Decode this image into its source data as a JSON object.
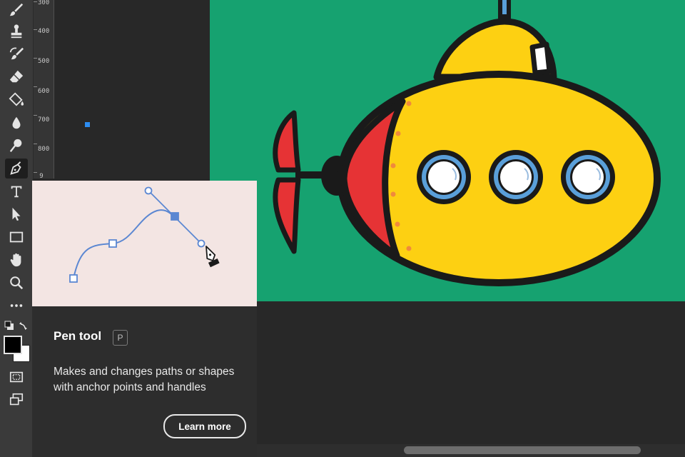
{
  "toolbar": {
    "tools": [
      {
        "name": "brush-tool-icon",
        "active": false
      },
      {
        "name": "clone-stamp-tool-icon",
        "active": false
      },
      {
        "name": "history-brush-tool-icon",
        "active": false
      },
      {
        "name": "eraser-tool-icon",
        "active": false
      },
      {
        "name": "paint-bucket-tool-icon",
        "active": false
      },
      {
        "name": "blur-tool-icon",
        "active": false
      },
      {
        "name": "dodge-tool-icon",
        "active": false
      },
      {
        "name": "pen-tool-icon",
        "active": true
      },
      {
        "name": "type-tool-icon",
        "active": false
      },
      {
        "name": "path-selection-tool-icon",
        "active": false
      },
      {
        "name": "rectangle-tool-icon",
        "active": false
      },
      {
        "name": "hand-tool-icon",
        "active": false
      },
      {
        "name": "zoom-tool-icon",
        "active": false
      },
      {
        "name": "more-tools-icon",
        "active": false
      }
    ],
    "foreground_color": "#000000",
    "background_color": "#ffffff"
  },
  "ruler": {
    "labels": [
      "300",
      "400",
      "500",
      "600",
      "700",
      "800",
      "9"
    ]
  },
  "canvas": {
    "background_color": "#16a270",
    "accent_colors": {
      "submarine_body": "#fdd012",
      "fin": "#e63335",
      "porthole_ring": "#5a9fd9",
      "outline": "#1a1a1a"
    }
  },
  "tooltip": {
    "title": "Pen tool",
    "shortcut": "P",
    "description": "Makes and changes paths or shapes with anchor points and handles",
    "button_label": "Learn more",
    "preview_background": "#f3e5e3",
    "path_color": "#5b87d2"
  }
}
